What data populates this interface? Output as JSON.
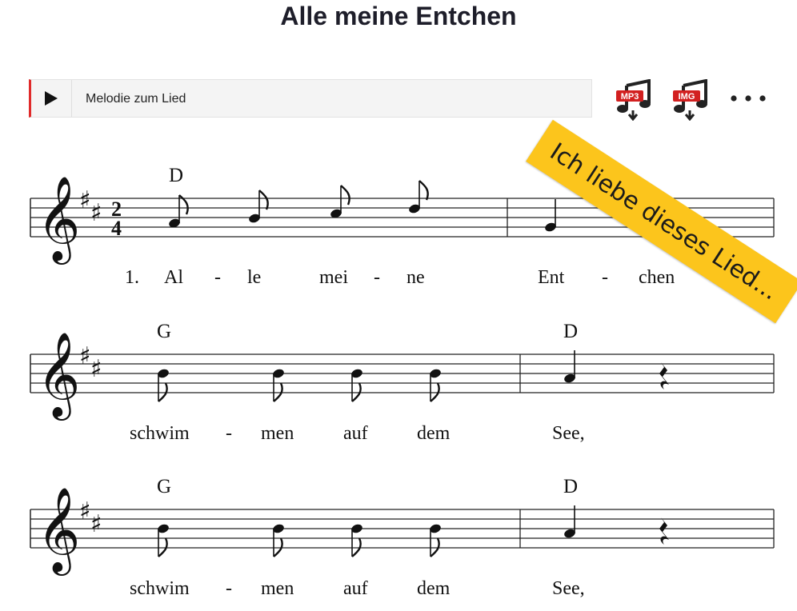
{
  "page": {
    "title": "Alle meine Entchen"
  },
  "player": {
    "label": "Melodie zum Lied",
    "play_icon": "play-icon"
  },
  "downloads": [
    {
      "badge": "MP3",
      "icon": "music-note-download-icon",
      "color": "#d22020"
    },
    {
      "badge": "IMG",
      "icon": "music-note-download-icon",
      "color": "#d22020"
    }
  ],
  "more": {
    "icon": "more-dots-icon"
  },
  "banner": {
    "text": "Ich liebe dieses Lied..."
  },
  "score": {
    "clef": "treble",
    "key": "D major (2 sharps)",
    "time": {
      "numerator": "2",
      "denominator": "4"
    },
    "systems": [
      {
        "chords": [
          "D"
        ],
        "lyrics": [
          "1.",
          "Al",
          "-",
          "le",
          "mei",
          "-",
          "ne",
          "Ent",
          "-",
          "chen"
        ],
        "notes": [
          "D4 eighth",
          "E4 eighth",
          "F#4 eighth",
          "G4 eighth",
          "A4 quarter"
        ]
      },
      {
        "chords": [
          "G",
          "D"
        ],
        "lyrics": [
          "schwim",
          "-",
          "men",
          "auf",
          "dem",
          "See,"
        ],
        "notes": [
          "B4 eighth",
          "B4 eighth",
          "B4 eighth",
          "B4 eighth",
          "A4 quarter",
          "quarter rest"
        ]
      },
      {
        "chords": [
          "G",
          "D"
        ],
        "lyrics": [
          "schwim",
          "-",
          "men",
          "auf",
          "dem",
          "See,"
        ],
        "notes": [
          "B4 eighth",
          "B4 eighth",
          "B4 eighth",
          "B4 eighth",
          "A4 quarter",
          "quarter rest"
        ]
      }
    ]
  }
}
